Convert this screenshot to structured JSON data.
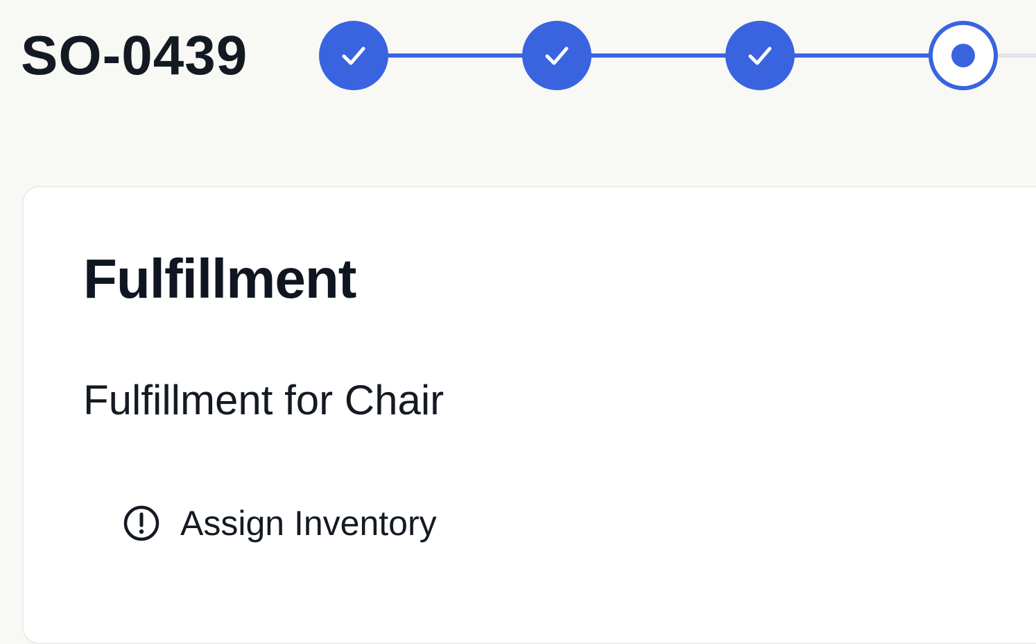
{
  "order": {
    "id": "SO-0439"
  },
  "stepper": {
    "steps": [
      {
        "status": "done",
        "icon": "check-icon"
      },
      {
        "status": "done",
        "icon": "check-icon"
      },
      {
        "status": "done",
        "icon": "check-icon"
      },
      {
        "status": "current",
        "icon": "current-step-dot-icon"
      }
    ],
    "accent_color": "#3a63e0",
    "pending_color": "#e4e4ea"
  },
  "card": {
    "title": "Fulfillment",
    "subtitle": "Fulfillment for Chair",
    "task": {
      "label": "Assign Inventory",
      "icon": "alert-circle-icon"
    }
  }
}
